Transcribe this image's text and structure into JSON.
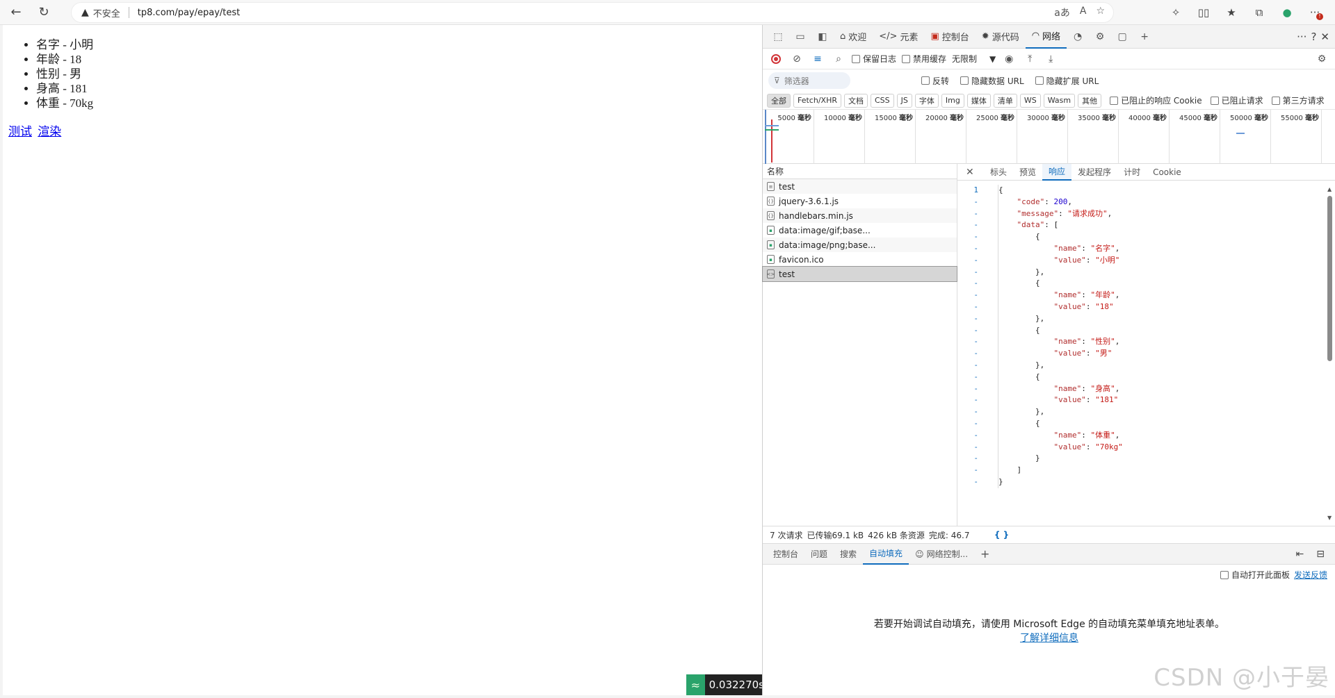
{
  "browser": {
    "insecure_label": "不安全",
    "url": "tp8.com/pay/epay/test"
  },
  "page": {
    "items": [
      "名字 - 小明",
      "年龄 - 18",
      "性别 - 男",
      "身高 - 181",
      "体重 - 70kg"
    ],
    "links": [
      "测试",
      "渲染"
    ],
    "timer": "0.032270s"
  },
  "devtools": {
    "tabs": [
      {
        "label": "欢迎",
        "icon": "home-icon"
      },
      {
        "label": "元素",
        "icon": "code-icon"
      },
      {
        "label": "控制台",
        "icon": "console-icon"
      },
      {
        "label": "源代码",
        "icon": "bug-icon"
      },
      {
        "label": "网络",
        "icon": "wifi-icon"
      }
    ],
    "toolbar": {
      "preserve_log": "保留日志",
      "disable_cache": "禁用缓存",
      "throttle": "无限制"
    },
    "filter": {
      "placeholder": "筛选器",
      "invert": "反转",
      "hide_data_url": "隐藏数据 URL",
      "hide_ext_url": "隐藏扩展 URL"
    },
    "types": [
      "全部",
      "Fetch/XHR",
      "文档",
      "CSS",
      "JS",
      "字体",
      "Img",
      "媒体",
      "清单",
      "WS",
      "Wasm",
      "其他"
    ],
    "type_checks": [
      "已阻止的响应 Cookie",
      "已阻止请求",
      "第三方请求"
    ],
    "ticks": [
      "5000",
      "10000",
      "15000",
      "20000",
      "25000",
      "30000",
      "35000",
      "40000",
      "45000",
      "50000",
      "55000"
    ],
    "tick_unit": "毫秒",
    "name_header": "名称",
    "requests": [
      {
        "name": "test",
        "icon": "document-icon"
      },
      {
        "name": "jquery-3.6.1.js",
        "icon": "script-icon"
      },
      {
        "name": "handlebars.min.js",
        "icon": "script-icon"
      },
      {
        "name": "data:image/gif;base...",
        "icon": "image-icon"
      },
      {
        "name": "data:image/png;base...",
        "icon": "image-icon"
      },
      {
        "name": "favicon.ico",
        "icon": "image-icon"
      },
      {
        "name": "test",
        "icon": "xhr-icon"
      }
    ],
    "detail_tabs": [
      "标头",
      "预览",
      "响应",
      "发起程序",
      "计时",
      "Cookie"
    ],
    "status": {
      "requests": "7 次请求",
      "transferred": "已传输69.1 kB",
      "resources": "426 kB 条资源",
      "finish": "完成: 46.7",
      "braces": "{ }"
    },
    "drawer_tabs": [
      "控制台",
      "问题",
      "搜索",
      "自动填充",
      "网络控制..."
    ],
    "drawer": {
      "auto_open": "自动打开此面板",
      "feedback": "发送反馈",
      "message": "若要开始调试自动填充，请使用 Microsoft Edge 的自动填充菜单填充地址表单。",
      "learn_more": "了解详细信息"
    }
  },
  "response_json": {
    "code_key": "\"code\"",
    "code_val": "200",
    "message_key": "\"message\"",
    "message_val": "\"请求成功\"",
    "data_key": "\"data\"",
    "entries": [
      {
        "name": "\"名字\"",
        "value": "\"小明\""
      },
      {
        "name": "\"年龄\"",
        "value": "\"18\""
      },
      {
        "name": "\"性别\"",
        "value": "\"男\""
      },
      {
        "name": "\"身高\"",
        "value": "\"181\""
      },
      {
        "name": "\"体重\"",
        "value": "\"70kg\""
      }
    ]
  },
  "watermark": "CSDN @小于晏"
}
